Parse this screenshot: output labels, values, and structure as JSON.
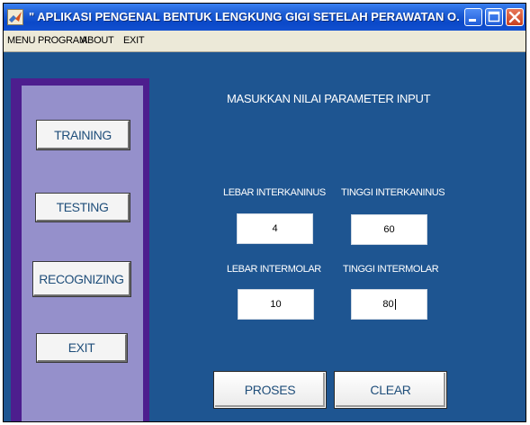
{
  "window": {
    "title": "\" APLIKASI PENGENAL BENTUK LENGKUNG GIGI SETELAH PERAWATAN O...",
    "controls": [
      "minimize-icon",
      "maximize-icon",
      "close-icon"
    ]
  },
  "menubar": {
    "items": [
      {
        "label": "MENU PROGRAM"
      },
      {
        "label": "ABOUT"
      },
      {
        "label": "EXIT"
      }
    ]
  },
  "sidebar": {
    "buttons": [
      {
        "label": "TRAINING"
      },
      {
        "label": "TESTING"
      },
      {
        "label": "RECOGNIZING"
      },
      {
        "label": "EXIT"
      }
    ]
  },
  "main": {
    "heading": "MASUKKAN NILAI PARAMETER INPUT",
    "fields": {
      "lebar_interkaninus": {
        "label": "LEBAR INTERKANINUS",
        "value": "4"
      },
      "tinggi_interkaninus": {
        "label": "TINGGI INTERKANINUS",
        "value": "60"
      },
      "lebar_intermolar": {
        "label": "LEBAR INTERMOLAR",
        "value": "10"
      },
      "tinggi_intermolar": {
        "label": "TINGGI INTERMOLAR",
        "value": "80"
      }
    },
    "actions": {
      "proses": "PROSES",
      "clear": "CLEAR"
    }
  },
  "colors": {
    "background": "#1e5591",
    "sidebar_outer": "#4d1e8e",
    "sidebar_inner": "#9590cb",
    "button_text": "#1f4e7a",
    "titlebar": "#0a48c8"
  }
}
